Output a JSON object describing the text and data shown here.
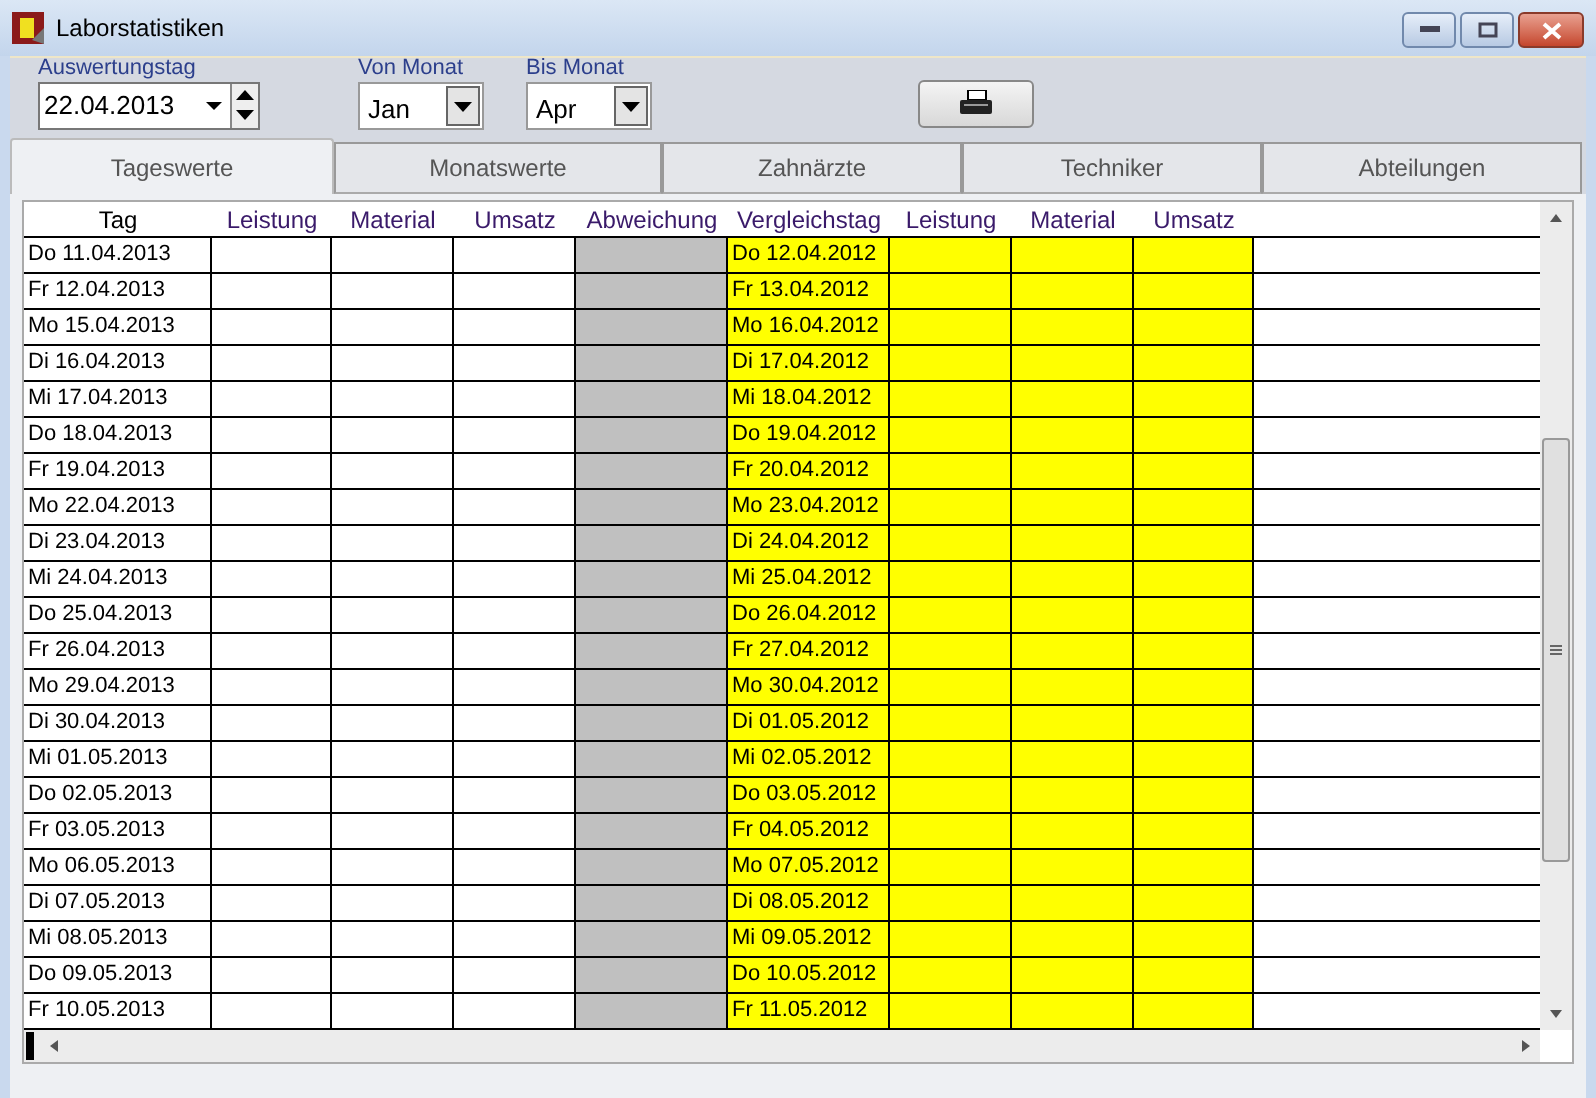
{
  "window": {
    "title": "Laborstatistiken"
  },
  "filters": {
    "date_label": "Auswertungstag",
    "date_value": "22.04.2013",
    "from_label": "Von Monat",
    "from_value": "Jan",
    "to_label": "Bis Monat",
    "to_value": "Apr"
  },
  "tabs": [
    {
      "label": "Tageswerte",
      "selected": true
    },
    {
      "label": "Monatswerte",
      "selected": false
    },
    {
      "label": "Zahnärzte",
      "selected": false
    },
    {
      "label": "Techniker",
      "selected": false
    },
    {
      "label": "Abteilungen",
      "selected": false
    }
  ],
  "table": {
    "columns": [
      {
        "label": "Tag",
        "kind": "date"
      },
      {
        "label": "Leistung",
        "kind": "value"
      },
      {
        "label": "Material",
        "kind": "value"
      },
      {
        "label": "Umsatz",
        "kind": "value"
      },
      {
        "label": "Abweichung",
        "kind": "deviation"
      },
      {
        "label": "Vergleichstag",
        "kind": "compare_date"
      },
      {
        "label": "Leistung",
        "kind": "compare_value"
      },
      {
        "label": "Material",
        "kind": "compare_value"
      },
      {
        "label": "Umsatz",
        "kind": "compare_value"
      }
    ],
    "rows": [
      {
        "tag": "Do 11.04.2013",
        "vergleichstag": "Do 12.04.2012"
      },
      {
        "tag": "Fr 12.04.2013",
        "vergleichstag": "Fr 13.04.2012"
      },
      {
        "tag": "Mo 15.04.2013",
        "vergleichstag": "Mo 16.04.2012"
      },
      {
        "tag": "Di 16.04.2013",
        "vergleichstag": "Di 17.04.2012"
      },
      {
        "tag": "Mi 17.04.2013",
        "vergleichstag": "Mi 18.04.2012"
      },
      {
        "tag": "Do 18.04.2013",
        "vergleichstag": "Do 19.04.2012"
      },
      {
        "tag": "Fr 19.04.2013",
        "vergleichstag": "Fr 20.04.2012"
      },
      {
        "tag": "Mo 22.04.2013",
        "vergleichstag": "Mo 23.04.2012"
      },
      {
        "tag": "Di 23.04.2013",
        "vergleichstag": "Di 24.04.2012"
      },
      {
        "tag": "Mi 24.04.2013",
        "vergleichstag": "Mi 25.04.2012"
      },
      {
        "tag": "Do 25.04.2013",
        "vergleichstag": "Do 26.04.2012"
      },
      {
        "tag": "Fr 26.04.2013",
        "vergleichstag": "Fr 27.04.2012"
      },
      {
        "tag": "Mo 29.04.2013",
        "vergleichstag": "Mo 30.04.2012"
      },
      {
        "tag": "Di 30.04.2013",
        "vergleichstag": "Di 01.05.2012"
      },
      {
        "tag": "Mi 01.05.2013",
        "vergleichstag": "Mi 02.05.2012"
      },
      {
        "tag": "Do 02.05.2013",
        "vergleichstag": "Do 03.05.2012"
      },
      {
        "tag": "Fr 03.05.2013",
        "vergleichstag": "Fr 04.05.2012"
      },
      {
        "tag": "Mo 06.05.2013",
        "vergleichstag": "Mo 07.05.2012"
      },
      {
        "tag": "Di 07.05.2013",
        "vergleichstag": "Di 08.05.2012"
      },
      {
        "tag": "Mi 08.05.2013",
        "vergleichstag": "Mi 09.05.2012"
      },
      {
        "tag": "Do 09.05.2013",
        "vergleichstag": "Do 10.05.2012"
      },
      {
        "tag": "Fr 10.05.2013",
        "vergleichstag": "Fr 11.05.2012"
      }
    ]
  }
}
